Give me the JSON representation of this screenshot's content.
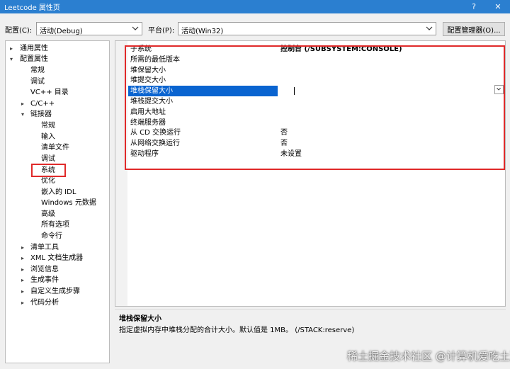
{
  "window": {
    "title": "Leetcode 属性页",
    "help": "?",
    "close": "✕"
  },
  "config_bar": {
    "config_label": "配置(C):",
    "config_value": "活动(Debug)",
    "platform_label": "平台(P):",
    "platform_value": "活动(Win32)",
    "manager_button": "配置管理器(O)..."
  },
  "tree": {
    "general": "通用属性",
    "config_props": "配置属性",
    "regular": "常规",
    "debug": "调试",
    "vc_dirs": "VC++ 目录",
    "cpp": "C/C++",
    "linker": "链接器",
    "linker_children": [
      "常规",
      "输入",
      "清单文件",
      "调试",
      "系统",
      "优化",
      "嵌入的 IDL",
      "Windows 元数据",
      "高级",
      "所有选项",
      "命令行"
    ],
    "after_linker": [
      "清单工具",
      "XML 文档生成器",
      "浏览信息",
      "生成事件",
      "自定义生成步骤",
      "代码分析"
    ]
  },
  "grid": {
    "rows": [
      {
        "name": "子系统",
        "value": "控制台 (/SUBSYSTEM:CONSOLE)"
      },
      {
        "name": "所需的最低版本",
        "value": ""
      },
      {
        "name": "堆保留大小",
        "value": ""
      },
      {
        "name": "堆提交大小",
        "value": ""
      },
      {
        "name": "堆栈保留大小",
        "value": ""
      },
      {
        "name": "堆栈提交大小",
        "value": ""
      },
      {
        "name": "启用大地址",
        "value": ""
      },
      {
        "name": "终端服务器",
        "value": ""
      },
      {
        "name": "从 CD 交换运行",
        "value": "否"
      },
      {
        "name": "从网络交换运行",
        "value": "否"
      },
      {
        "name": "驱动程序",
        "value": "未设置"
      }
    ],
    "selected_index": 4
  },
  "description": {
    "heading": "堆栈保留大小",
    "text": "指定虚拟内存中堆栈分配的合计大小。默认值是 1MB。    (/STACK:reserve)"
  },
  "watermark": "稀土掘金技术社区 @计算机爱吃土豆"
}
